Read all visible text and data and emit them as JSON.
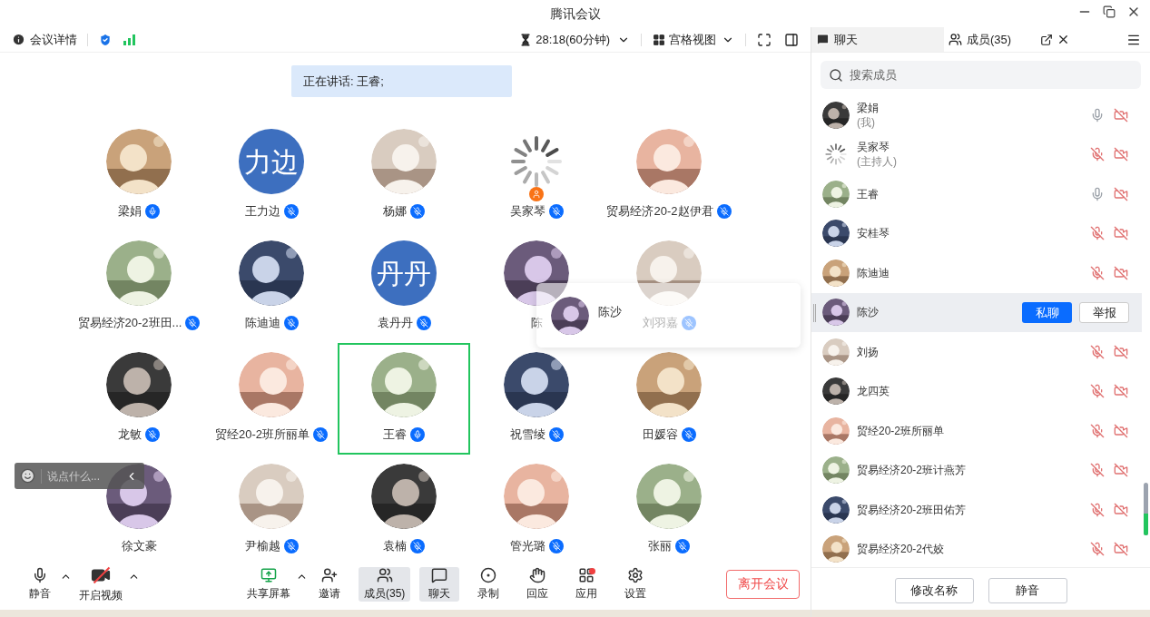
{
  "window": {
    "title": "腾讯会议"
  },
  "top_bar": {
    "details": "会议详情",
    "timer": "28:18(60分钟)",
    "view": "宫格视图"
  },
  "speaking_banner": "正在讲话: 王睿;",
  "participants": [
    {
      "name": "梁娟",
      "kind": "picture",
      "mic_icon": true,
      "muted": false,
      "speaking": false,
      "host": false
    },
    {
      "name": "王力边",
      "kind": "text",
      "avatar_text": "力边",
      "mic_icon": true,
      "muted": true,
      "speaking": false,
      "host": false
    },
    {
      "name": "杨娜",
      "kind": "picture",
      "mic_icon": true,
      "muted": true,
      "speaking": false,
      "host": false
    },
    {
      "name": "吴家琴",
      "kind": "loading",
      "mic_icon": true,
      "muted": true,
      "speaking": false,
      "host": true
    },
    {
      "name": "贸易经济20-2赵伊君",
      "kind": "picture",
      "mic_icon": true,
      "muted": true,
      "speaking": false,
      "host": false
    },
    {
      "name": "贸易经济20-2班田...",
      "kind": "picture",
      "mic_icon": true,
      "muted": true,
      "speaking": false,
      "host": false
    },
    {
      "name": "陈迪迪",
      "kind": "picture",
      "mic_icon": true,
      "muted": true,
      "speaking": false,
      "host": false
    },
    {
      "name": "袁丹丹",
      "kind": "text",
      "avatar_text": "丹丹",
      "mic_icon": true,
      "muted": true,
      "speaking": false,
      "host": false
    },
    {
      "name": "陈",
      "kind": "picture",
      "mic_icon": false,
      "speaking": false,
      "host": false
    },
    {
      "name": "刘羽嘉",
      "kind": "picture",
      "mic_icon": true,
      "muted": true,
      "speaking": false,
      "host": false
    },
    {
      "name": "龙敏",
      "kind": "picture",
      "mic_icon": true,
      "muted": true,
      "speaking": false,
      "host": false
    },
    {
      "name": "贸经20-2班所丽单",
      "kind": "picture",
      "mic_icon": true,
      "muted": true,
      "speaking": false,
      "host": false
    },
    {
      "name": "王睿",
      "kind": "picture",
      "mic_icon": true,
      "muted": false,
      "speaking": true,
      "host": false
    },
    {
      "name": "祝雪绫",
      "kind": "picture",
      "mic_icon": true,
      "muted": true,
      "speaking": false,
      "host": false
    },
    {
      "name": "田媛容",
      "kind": "picture",
      "mic_icon": true,
      "muted": true,
      "speaking": false,
      "host": false
    },
    {
      "name": "徐文豪",
      "kind": "picture",
      "mic_icon": false,
      "speaking": false,
      "host": false
    },
    {
      "name": "尹榆越",
      "kind": "picture",
      "mic_icon": true,
      "muted": true,
      "speaking": false,
      "host": false
    },
    {
      "name": "袁楠",
      "kind": "picture",
      "mic_icon": true,
      "muted": true,
      "speaking": false,
      "host": false
    },
    {
      "name": "管光璐",
      "kind": "picture",
      "mic_icon": true,
      "muted": true,
      "speaking": false,
      "host": false
    },
    {
      "name": "张丽",
      "kind": "picture",
      "mic_icon": true,
      "muted": true,
      "speaking": false,
      "host": false
    }
  ],
  "hover_card": {
    "name": "陈沙"
  },
  "chat_input": {
    "placeholder": "说点什么..."
  },
  "toolbar": [
    {
      "label": "静音",
      "kind": "mic",
      "selected": false,
      "caret": true
    },
    {
      "label": "开启视频",
      "kind": "video",
      "selected": false,
      "caret": true
    },
    {
      "label": "共享屏幕",
      "kind": "share",
      "selected": false,
      "caret": true
    },
    {
      "label": "邀请",
      "kind": "invite",
      "selected": false,
      "caret": false
    },
    {
      "label": "成员(35)",
      "kind": "members",
      "selected": true,
      "caret": false
    },
    {
      "label": "聊天",
      "kind": "chat",
      "selected": true,
      "caret": false
    },
    {
      "label": "录制",
      "kind": "record",
      "selected": false,
      "caret": false
    },
    {
      "label": "回应",
      "kind": "react",
      "selected": false,
      "caret": false
    },
    {
      "label": "应用",
      "kind": "apps",
      "selected": false,
      "caret": false,
      "badge": true
    },
    {
      "label": "设置",
      "kind": "settings",
      "selected": false,
      "caret": false
    }
  ],
  "leave_button": "离开会议",
  "side_panel": {
    "tabs": [
      {
        "label": "聊天",
        "kind": "chat",
        "selected": false
      },
      {
        "label": "成员(35)",
        "kind": "members",
        "selected": true
      }
    ],
    "search": {
      "placeholder": "搜索成员"
    },
    "members": [
      {
        "name": "梁娟",
        "role": "(我)",
        "kind": "picture",
        "muted": false,
        "camera_off": true,
        "hovered": false
      },
      {
        "name": "吴家琴",
        "role": "(主持人)",
        "kind": "loading",
        "muted": true,
        "camera_off": true,
        "hovered": false
      },
      {
        "name": "王睿",
        "kind": "picture",
        "muted": false,
        "camera_off": true,
        "hovered": false
      },
      {
        "name": "安桂琴",
        "kind": "picture",
        "muted": true,
        "camera_off": true,
        "hovered": false
      },
      {
        "name": "陈迪迪",
        "kind": "picture",
        "muted": true,
        "camera_off": true,
        "hovered": false
      },
      {
        "name": "陈沙",
        "kind": "picture",
        "hovered": true
      },
      {
        "name": "刘扬",
        "kind": "picture",
        "muted": true,
        "camera_off": true,
        "hovered": false
      },
      {
        "name": "龙四英",
        "kind": "picture",
        "muted": true,
        "camera_off": true,
        "hovered": false
      },
      {
        "name": "贸经20-2班所丽单",
        "kind": "picture",
        "muted": true,
        "camera_off": true,
        "hovered": false
      },
      {
        "name": "贸易经济20-2班计燕芳",
        "kind": "picture",
        "muted": true,
        "camera_off": true,
        "hovered": false
      },
      {
        "name": "贸易经济20-2班田佑芳",
        "kind": "picture",
        "muted": true,
        "camera_off": true,
        "hovered": false
      },
      {
        "name": "贸易经济20-2代姣",
        "kind": "picture",
        "muted": true,
        "camera_off": true,
        "hovered": false
      }
    ],
    "row_actions": [
      "私聊",
      "举报"
    ],
    "bottom_buttons": [
      "修改名称",
      "静音"
    ]
  }
}
